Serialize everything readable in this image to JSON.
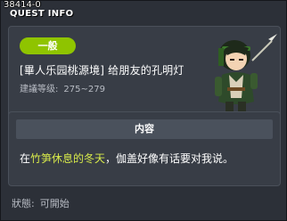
{
  "quest_id": "38414-0",
  "window_title": "QUEST INFO",
  "quest": {
    "category_badge": "一般",
    "name": "[畢人乐园桃源境] 给朋友的孔明灯",
    "level_label": "建議等级:",
    "level_range": "275~279",
    "badge_color": "#8fc400"
  },
  "content": {
    "header": "内容",
    "text_prefix": "在",
    "highlight": "竹笋休息的冬天",
    "text_suffix": "，伽盖好像有话要对我说。",
    "highlight_color": "#d8ea4a"
  },
  "status": {
    "label": "狀態:",
    "value": "可開始"
  },
  "npc": {
    "portrait": "npc-portrait-zhuge"
  }
}
